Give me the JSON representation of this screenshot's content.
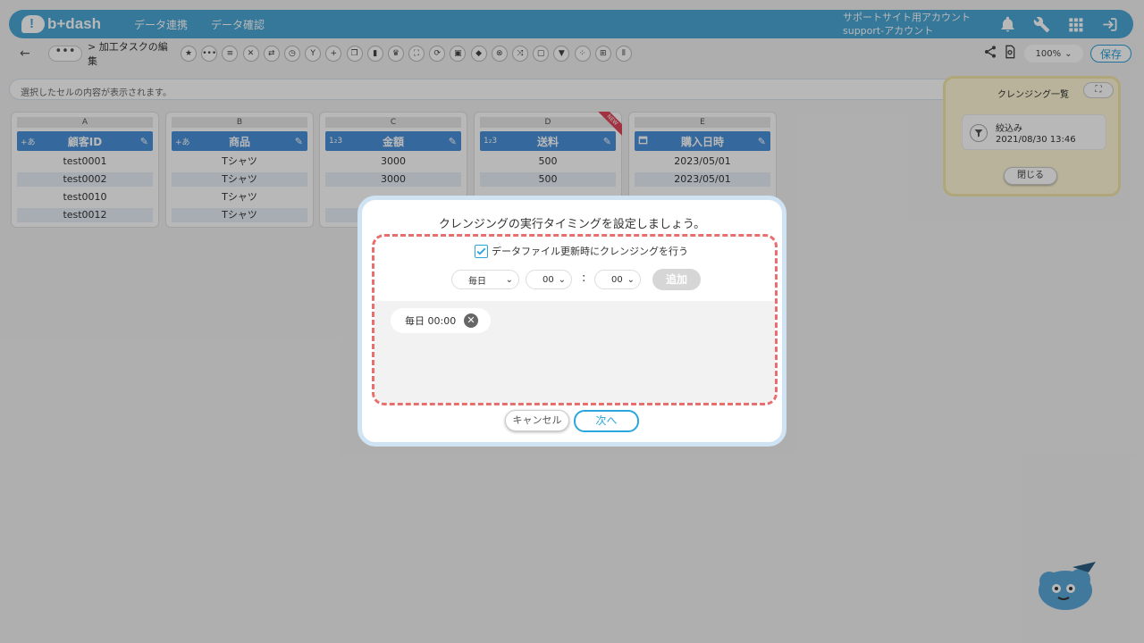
{
  "colors": {
    "accent": "#2aa6dd",
    "header": "#4aa7d6",
    "column_header": "#4a90d9",
    "highlight": "#e7706f"
  },
  "header": {
    "logo": "b+dash",
    "nav": [
      "データ連携",
      "データ確認"
    ],
    "account_line1": "サポートサイト用アカウント",
    "account_line2": "support-アカウント",
    "icons": [
      "bell-icon",
      "wrench-icon",
      "apps-grid-icon",
      "logout-icon"
    ]
  },
  "toolbar": {
    "back": "←",
    "more": "•••",
    "breadcrumb": "> 加工タスクの編集",
    "zoom": "100%",
    "save_label": "保存"
  },
  "cellbar": {
    "placeholder": "選択したセルの内容が表示されます。"
  },
  "columns": [
    {
      "letter": "A",
      "name": "顧客ID",
      "type": "+あ",
      "cells": [
        "test0001",
        "test0002",
        "test0010",
        "test0012"
      ]
    },
    {
      "letter": "B",
      "name": "商品",
      "type": "+あ",
      "cells": [
        "Tシャツ",
        "Tシャツ",
        "Tシャツ",
        "Tシャツ"
      ]
    },
    {
      "letter": "C",
      "name": "金額",
      "type": "1₂3",
      "cells": [
        "3000",
        "3000",
        "",
        ""
      ]
    },
    {
      "letter": "D",
      "name": "送料",
      "type": "1₂3",
      "cells": [
        "500",
        "500",
        "",
        ""
      ],
      "badge": "NEW"
    },
    {
      "letter": "E",
      "name": "購入日時",
      "type": "",
      "cells": [
        "2023/05/01",
        "2023/05/01",
        "",
        ""
      ]
    }
  ],
  "side_panel": {
    "title": "クレンジング一覧",
    "item_title": "絞込み",
    "item_date": "2021/08/30 13:46",
    "close_label": "閉じる"
  },
  "modal": {
    "title": "クレンジングの実行タイミングを設定しましょう。",
    "checkbox_label": "データファイル更新時にクレンジングを行う",
    "checked": true,
    "frequency": "毎日",
    "hour": "00",
    "colon": ":",
    "minute": "00",
    "add_label": "追加",
    "schedules": [
      "毎日 00:00"
    ],
    "cancel_label": "キャンセル",
    "next_label": "次へ"
  }
}
